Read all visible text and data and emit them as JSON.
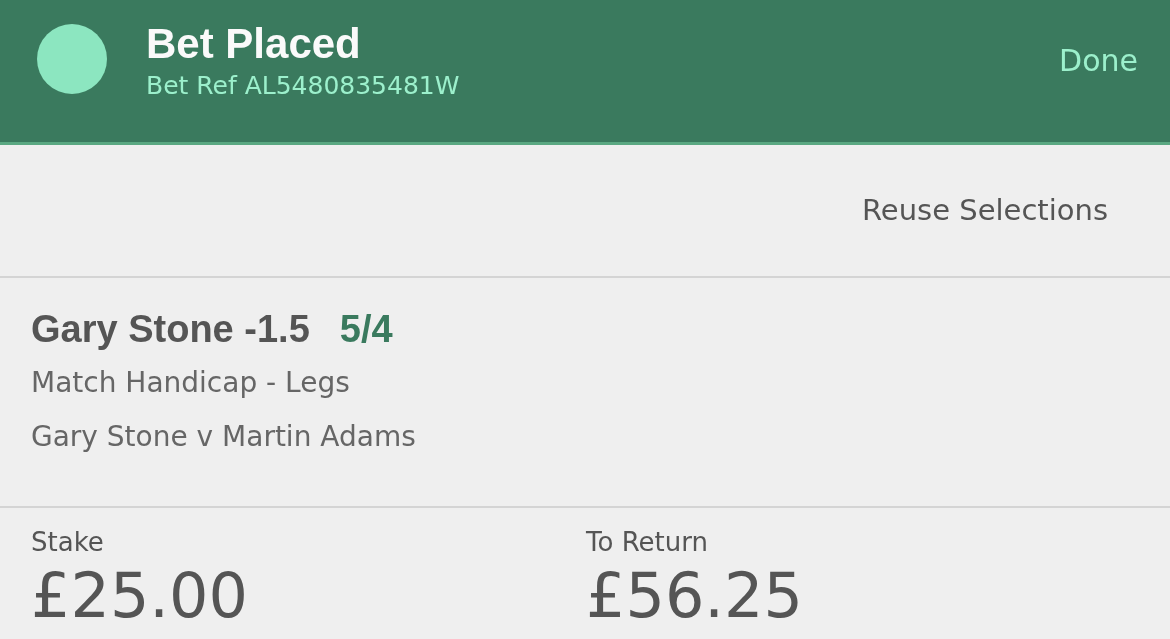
{
  "header": {
    "title": "Bet Placed",
    "bet_ref": "Bet Ref AL5480835481W",
    "done": "Done"
  },
  "reuse": "Reuse Selections",
  "selection": {
    "name": "Gary Stone -1.5",
    "odds": "5/4",
    "market": "Match Handicap - Legs",
    "event": "Gary Stone v Martin Adams"
  },
  "totals": [
    {
      "label": "Stake",
      "value": "£25.00"
    },
    {
      "label": "To Return",
      "value": "£56.25"
    }
  ]
}
